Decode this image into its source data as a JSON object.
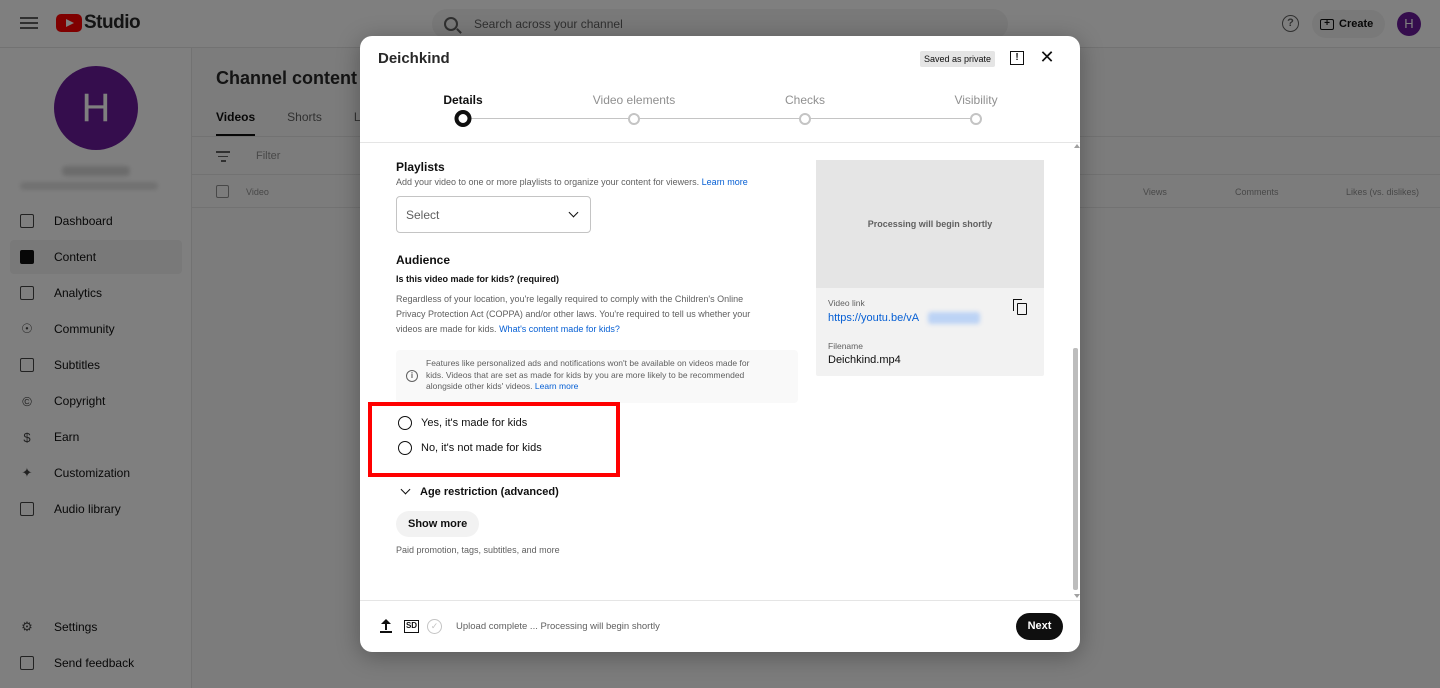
{
  "app": {
    "logo_text": "Studio",
    "search_placeholder": "Search across your channel",
    "create_label": "Create",
    "avatar_initial": "H"
  },
  "sidebar": {
    "avatar_initial": "H",
    "items": [
      {
        "label": "Dashboard",
        "icon": "dashboard-icon"
      },
      {
        "label": "Content",
        "icon": "content-icon",
        "active": true
      },
      {
        "label": "Analytics",
        "icon": "analytics-icon"
      },
      {
        "label": "Community",
        "icon": "community-icon"
      },
      {
        "label": "Subtitles",
        "icon": "subtitles-icon"
      },
      {
        "label": "Copyright",
        "icon": "copyright-icon"
      },
      {
        "label": "Earn",
        "icon": "earn-icon"
      },
      {
        "label": "Customization",
        "icon": "customization-icon"
      },
      {
        "label": "Audio library",
        "icon": "audio-library-icon"
      }
    ],
    "settings_label": "Settings",
    "feedback_label": "Send feedback"
  },
  "main": {
    "title": "Channel content",
    "tabs": [
      "Videos",
      "Shorts",
      "L"
    ],
    "filter_label": "Filter",
    "columns": {
      "video": "Video",
      "views": "Views",
      "comments": "Comments",
      "likes": "Likes (vs. dislikes)"
    }
  },
  "dialog": {
    "title": "Deichkind",
    "saved_badge": "Saved as private",
    "steps": [
      "Details",
      "Video elements",
      "Checks",
      "Visibility"
    ],
    "playlists": {
      "title": "Playlists",
      "desc": "Add your video to one or more playlists to organize your content for viewers.",
      "learn_more": "Learn more",
      "select_label": "Select"
    },
    "audience": {
      "title": "Audience",
      "question": "Is this video made for kids? (required)",
      "desc_line1": "Regardless of your location, you're legally required to comply with the Children's Online",
      "desc_line2": "Privacy Protection Act (COPPA) and/or other laws. You're required to tell us whether your",
      "desc_line3": "videos are made for kids.",
      "desc_link": "What's content made for kids?",
      "info_line1": "Features like personalized ads and notifications won't be available on videos made for",
      "info_line2": "kids. Videos that are set as made for kids by you are more likely to be recommended",
      "info_line3": "alongside other kids' videos.",
      "info_link": "Learn more",
      "option_yes": "Yes, it's made for kids",
      "option_no": "No, it's not made for kids"
    },
    "age_restriction": "Age restriction (advanced)",
    "show_more": "Show more",
    "show_more_desc": "Paid promotion, tags, subtitles, and more",
    "preview": {
      "processing": "Processing will begin shortly",
      "video_link_label": "Video link",
      "video_link": "https://youtu.be/vA",
      "filename_label": "Filename",
      "filename": "Deichkind.mp4"
    },
    "footer": {
      "sd_badge": "SD",
      "status": "Upload complete ... Processing will begin shortly",
      "next_label": "Next"
    }
  }
}
